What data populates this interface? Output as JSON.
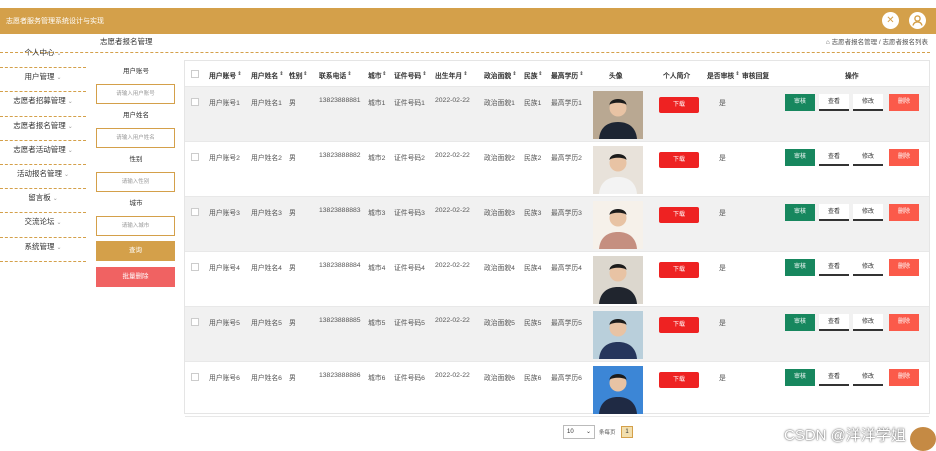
{
  "app": {
    "title": "志愿者服务管理系统设计与实现"
  },
  "header": {
    "page_title": "志愿者报名管理",
    "breadcrumb": "志愿者报名管理 / 志愿者报名列表"
  },
  "sidebar": {
    "items": [
      {
        "label": "个人中心"
      },
      {
        "label": "用户管理"
      },
      {
        "label": "志愿者招募管理"
      },
      {
        "label": "志愿者报名管理"
      },
      {
        "label": "志愿者活动管理"
      },
      {
        "label": "活动报名管理"
      },
      {
        "label": "留言板"
      },
      {
        "label": "交流论坛"
      },
      {
        "label": "系统管理"
      }
    ]
  },
  "search": {
    "fields": [
      {
        "label": "用户账号",
        "placeholder": "请输入用户账号"
      },
      {
        "label": "用户姓名",
        "placeholder": "请输入用户姓名"
      },
      {
        "label": "性别",
        "placeholder": "请输入性别"
      },
      {
        "label": "城市",
        "placeholder": "请输入城市"
      }
    ],
    "query_label": "查询",
    "batch_delete_label": "批量删除"
  },
  "table": {
    "headers": [
      "用户账号",
      "用户姓名",
      "性别",
      "联系电话",
      "城市",
      "证件号码",
      "出生年月",
      "政治面貌",
      "民族",
      "最高学历",
      "头像",
      "个人简介",
      "是否审核",
      "审核回复",
      "操作"
    ],
    "rows": [
      {
        "account": "用户账号1",
        "name": "用户姓名1",
        "gender": "男",
        "phone": "13823888881",
        "city": "城市1",
        "id_no": "证件号码1",
        "birth": "2022-02-22",
        "politics": "政治面貌1",
        "ethnic": "民族1",
        "edu": "最高学历1",
        "intro_btn": "下载",
        "audit": "是",
        "reply": ""
      },
      {
        "account": "用户账号2",
        "name": "用户姓名2",
        "gender": "男",
        "phone": "13823888882",
        "city": "城市2",
        "id_no": "证件号码2",
        "birth": "2022-02-22",
        "politics": "政治面貌2",
        "ethnic": "民族2",
        "edu": "最高学历2",
        "intro_btn": "下载",
        "audit": "是",
        "reply": ""
      },
      {
        "account": "用户账号3",
        "name": "用户姓名3",
        "gender": "男",
        "phone": "13823888883",
        "city": "城市3",
        "id_no": "证件号码3",
        "birth": "2022-02-22",
        "politics": "政治面貌3",
        "ethnic": "民族3",
        "edu": "最高学历3",
        "intro_btn": "下载",
        "audit": "是",
        "reply": ""
      },
      {
        "account": "用户账号4",
        "name": "用户姓名4",
        "gender": "男",
        "phone": "13823888884",
        "city": "城市4",
        "id_no": "证件号码4",
        "birth": "2022-02-22",
        "politics": "政治面貌4",
        "ethnic": "民族4",
        "edu": "最高学历4",
        "intro_btn": "下载",
        "audit": "是",
        "reply": ""
      },
      {
        "account": "用户账号5",
        "name": "用户姓名5",
        "gender": "男",
        "phone": "13823888885",
        "city": "城市5",
        "id_no": "证件号码5",
        "birth": "2022-02-22",
        "politics": "政治面貌5",
        "ethnic": "民族5",
        "edu": "最高学历5",
        "intro_btn": "下载",
        "audit": "是",
        "reply": ""
      },
      {
        "account": "用户账号6",
        "name": "用户姓名6",
        "gender": "男",
        "phone": "13823888886",
        "city": "城市6",
        "id_no": "证件号码6",
        "birth": "2022-02-22",
        "politics": "政治面貌6",
        "ethnic": "民族6",
        "edu": "最高学历6",
        "intro_btn": "下载",
        "audit": "是",
        "reply": ""
      }
    ],
    "actions": {
      "audit": "审核",
      "view": "查看",
      "edit": "修改",
      "delete": "删除"
    }
  },
  "pagination": {
    "page_size": "10",
    "page_size_label": "条每页",
    "current_page": "1"
  },
  "watermark": "CSDN @洋洋学姐",
  "colors": {
    "accent": "#d4a04a",
    "audit": "#17875e",
    "delete": "#fb5a4a",
    "download": "#ee2222"
  }
}
